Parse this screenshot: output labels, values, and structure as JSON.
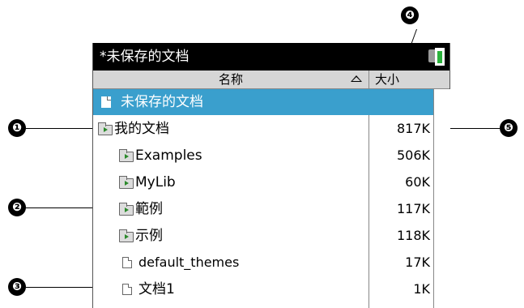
{
  "window": {
    "title": "*未保存的文档"
  },
  "header": {
    "name_label": "名称",
    "size_label": "大小"
  },
  "rows": [
    {
      "name": "未保存的文档",
      "size": "",
      "icon": "document-icon",
      "selected": true
    },
    {
      "name": "我的文档",
      "size": "817K",
      "icon": "folder-open-icon"
    },
    {
      "name": "Examples",
      "size": "506K",
      "icon": "folder-icon"
    },
    {
      "name": "MyLib",
      "size": "60K",
      "icon": "folder-icon"
    },
    {
      "name": "範例",
      "size": "117K",
      "icon": "folder-icon"
    },
    {
      "name": "示例",
      "size": "118K",
      "icon": "folder-icon"
    },
    {
      "name": "default_themes",
      "size": "17K",
      "icon": "document-icon"
    },
    {
      "name": "文档1",
      "size": "1K",
      "icon": "document-icon"
    }
  ],
  "callouts": [
    "❶",
    "❷",
    "❸",
    "❹",
    "❺"
  ],
  "colors": {
    "titlebar": "#000000",
    "selected_row": "#3a9fcd",
    "header": "#d6d6d6",
    "battery": "#2bb23c"
  }
}
